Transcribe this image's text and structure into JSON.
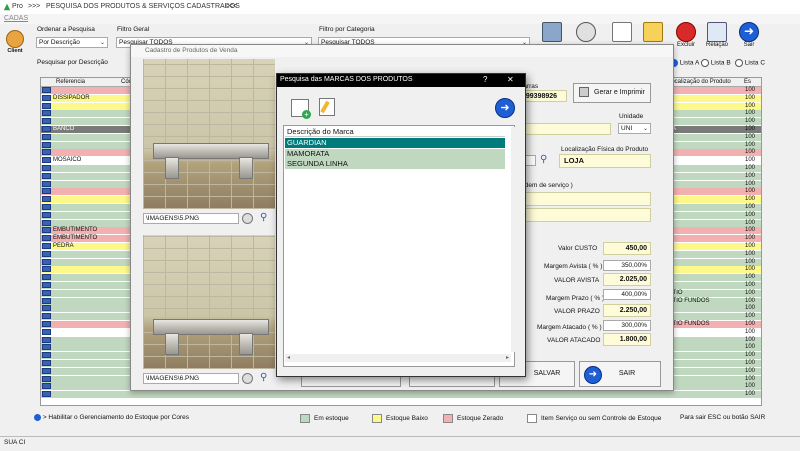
{
  "window": {
    "title": "PESQUISA DOS PRODUTOS & SERVIÇOS CADASTRADOS",
    "title_prefix": ">>>",
    "title_suffix": "<<<",
    "app_label": "Pro",
    "menu": "CADAS"
  },
  "filters": {
    "ordenar_label": "Ordenar a Pesquisa",
    "ordenar_value": "Por Descrição",
    "filtro_geral_label": "Filtro Geral",
    "filtro_geral_value": "Pesquisar TODOS",
    "filtro_categoria_label": "Filtro por Categoria",
    "filtro_categoria_value": "Pesquisar TODOS",
    "pesquisar_label": "Pesquisar por Descrição"
  },
  "toolbar": {
    "excluir": "Excluir",
    "relacao": "Relação",
    "sair": "Sair",
    "client": "Client"
  },
  "lista": {
    "a": "Lista A",
    "b": "Lista B",
    "c": "Lista C"
  },
  "grid": {
    "col_referencia": "Referencia",
    "col_cod": "Cód",
    "col_localizacao": "Localização do Produto",
    "col_es": "Es",
    "rows": [
      {
        "text": "",
        "color": "#f3b0b0",
        "right": "100"
      },
      {
        "text": "DISSIPADOR",
        "color": "#fcf88a",
        "right": "100"
      },
      {
        "text": "",
        "color": "#fcf88a",
        "right": "100"
      },
      {
        "text": "",
        "color": "#c0d8c0",
        "right": "100"
      },
      {
        "text": "",
        "color": "#c0d8c0",
        "right": "100"
      },
      {
        "text": "BANCO",
        "color": "#7a7a7a",
        "right": "100"
      },
      {
        "text": "",
        "color": "#c0d8c0",
        "right": "100"
      },
      {
        "text": "",
        "color": "#c0d8c0",
        "right": "100"
      },
      {
        "text": "",
        "color": "#f3b0b0",
        "right": "100"
      },
      {
        "text": "MOSAICO",
        "color": "#ffffff",
        "right": "100"
      },
      {
        "text": "",
        "color": "#c0d8c0",
        "right": "100"
      },
      {
        "text": "",
        "color": "#c0d8c0",
        "right": "100"
      },
      {
        "text": "",
        "color": "#c0d8c0",
        "right": "100"
      },
      {
        "text": "",
        "color": "#f3b0b0",
        "right": "100"
      },
      {
        "text": "",
        "color": "#fcf88a",
        "right": "100"
      },
      {
        "text": "",
        "color": "#c0d8c0",
        "right": "100"
      },
      {
        "text": "",
        "color": "#c0d8c0",
        "right": "100"
      },
      {
        "text": "",
        "color": "#c0d8c0",
        "right": "100"
      },
      {
        "text": "EMBUTIMENTO",
        "color": "#f3b0b0",
        "right": "100"
      },
      {
        "text": "EMBUTIMENTO",
        "color": "#f3b0b0",
        "right": "100"
      },
      {
        "text": "PEDRA",
        "color": "#fcf88a",
        "right": "100"
      },
      {
        "text": "",
        "color": "#c0d8c0",
        "right": "100"
      },
      {
        "text": "",
        "color": "#c0d8c0",
        "right": "100"
      },
      {
        "text": "",
        "color": "#fcf88a",
        "right": "100"
      },
      {
        "text": "",
        "color": "#c0d8c0",
        "right": "100"
      },
      {
        "text": "",
        "color": "#c0d8c0",
        "right": "100"
      },
      {
        "text": "",
        "color": "#c0d8c0",
        "right": "100"
      },
      {
        "text": "",
        "color": "#c0d8c0",
        "right": "100"
      },
      {
        "text": "",
        "color": "#c0d8c0",
        "right": "100"
      },
      {
        "text": "",
        "color": "#c0d8c0",
        "right": "100"
      },
      {
        "text": "",
        "color": "#f3b0b0",
        "right": "100"
      },
      {
        "text": "",
        "color": "#ffffff",
        "right": "100"
      },
      {
        "text": "",
        "color": "#c0d8c0",
        "right": "100"
      },
      {
        "text": "",
        "color": "#c0d8c0",
        "right": "100"
      },
      {
        "text": "",
        "color": "#c0d8c0",
        "right": "100"
      },
      {
        "text": "",
        "color": "#c0d8c0",
        "right": "100"
      },
      {
        "text": "",
        "color": "#c0d8c0",
        "right": "100"
      },
      {
        "text": "",
        "color": "#c0d8c0",
        "right": "100"
      },
      {
        "text": "",
        "color": "#c0d8c0",
        "right": "100"
      },
      {
        "text": "",
        "color": "#c0d8c0",
        "right": "100"
      }
    ],
    "loc_values": [
      "ATIO",
      "ATIO FUNDOS",
      "ATIO FUNDOS"
    ],
    "loc_hoja": "JA"
  },
  "cadastro": {
    "title": "Cadastro de Produtos de Venda",
    "img1_path": "\\IMAGENS\\5.PNG",
    "img2_path": "\\IMAGENS\\6.PNG",
    "barras_label": "Barras",
    "barras_value": "199398926",
    "gerar_label": "Gerar e Imprimir",
    "unidade_label": "Unidade",
    "unidade_value": "UNI",
    "localizacao_label": "Localização Física do Produto",
    "localizacao_value": "LOJA",
    "ordem_label": "ordem de serviço )",
    "valor_custo_label": "Valor CUSTO",
    "valor_custo": "450,00",
    "margem_avista_label": "Margem Avista ( % )",
    "margem_avista": "350,00%",
    "valor_avista_label": "VALOR AVISTA",
    "valor_avista": "2.025,00",
    "margem_prazo_label": "Margem Prazo ( % )",
    "margem_prazo": "400,00%",
    "valor_prazo_label": "VALOR PRAZO",
    "valor_prazo": "2.250,00",
    "margem_atacado_label": "Margem Atacado ( % )",
    "margem_atacado": "300,00%",
    "valor_atacado_label": "VALOR ATACADO",
    "valor_atacado": "1.800,00",
    "salvar_label": "SALVAR",
    "sair_label": "SAIR"
  },
  "marcas": {
    "title": "Pesquisa das MARCAS DOS PRODUTOS",
    "help": "?",
    "close": "✕",
    "header": "Descrição do Marca",
    "items": [
      {
        "label": "GUARDIAN",
        "selected": true
      },
      {
        "label": "MAMORATA",
        "selected": false
      },
      {
        "label": "SEGUNDA LINHA",
        "selected": false
      }
    ]
  },
  "legend": {
    "habilitar": "> Habilitar o Gerenciamento do Estoque por Cores",
    "em_estoque": "Em estoque",
    "estoque_baixo": "Estoque Baixo",
    "estoque_zerado": "Estoque Zerado",
    "item_servico": "Item Serviço ou sem Controle de Estoque",
    "sair_hint": "Para sair ESC ou botão SAIR"
  },
  "colors": {
    "em_estoque": "#c0d8c0",
    "estoque_baixo": "#fcf88a",
    "estoque_zerado": "#f3b0b0",
    "item_servico": "#ffffff",
    "selected": "#007b7b",
    "accent_blue": "#1e5fd6"
  },
  "status": {
    "left": "SUA CI"
  }
}
